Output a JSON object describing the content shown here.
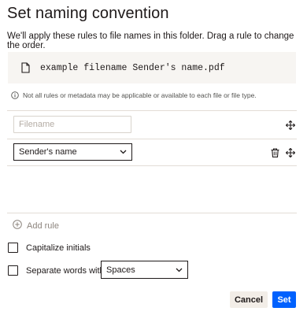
{
  "dialog": {
    "title": "Set naming convention",
    "description": "We'll apply these rules to file names in this folder. Drag a rule to change the order."
  },
  "preview": {
    "filename": "example filename Sender's name.pdf",
    "icon": "file-icon"
  },
  "note": {
    "icon": "info-icon",
    "text": "Not all rules or metadata may be applicable or available to each file or file type."
  },
  "rules": {
    "input_placeholder": "Filename",
    "input_value": "",
    "select_value": "Sender's name",
    "move_icon": "move-icon",
    "delete_icon": "trash-icon"
  },
  "add_rule": {
    "label": "Add rule",
    "icon": "plus-circle-icon"
  },
  "options": {
    "capitalize_label": "Capitalize initials",
    "capitalize_checked": false,
    "separate_label": "Separate words with",
    "separate_checked": false,
    "separator_value": "Spaces"
  },
  "actions": {
    "cancel_label": "Cancel",
    "set_label": "Set"
  },
  "colors": {
    "primary": "#0061fe",
    "cancel_bg": "#f2ede7",
    "preview_bg": "#f7f5f2",
    "text": "#1e1919"
  }
}
